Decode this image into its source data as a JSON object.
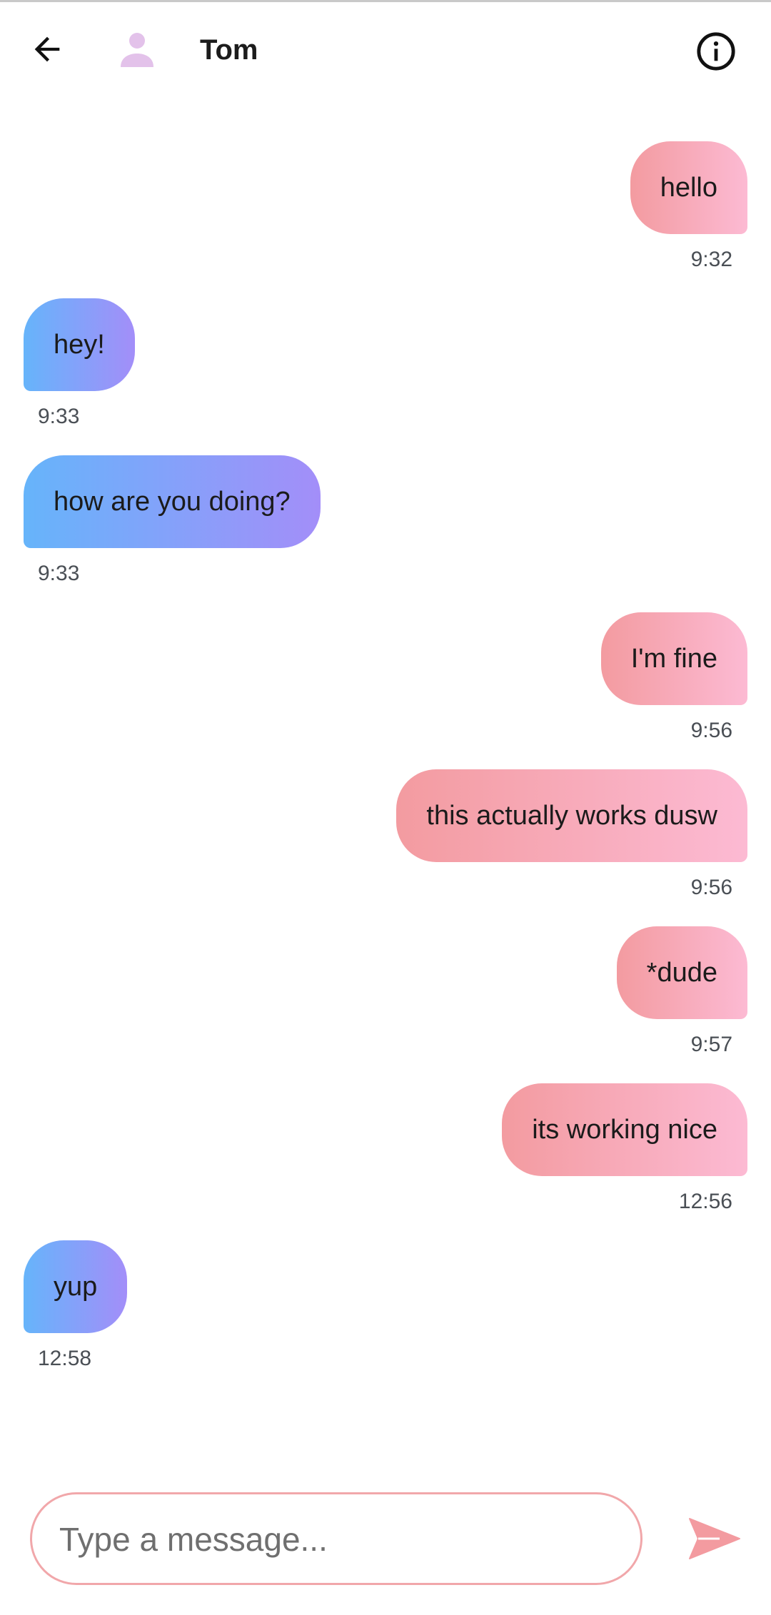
{
  "header": {
    "contact_name": "Tom",
    "back_icon": "arrow-left-icon",
    "avatar_icon": "person-icon",
    "info_icon": "info-circle-icon"
  },
  "messages": [
    {
      "side": "sent",
      "text": "hello",
      "time": "9:32"
    },
    {
      "side": "received",
      "text": "hey!",
      "time": "9:33"
    },
    {
      "side": "received",
      "text": "how are you doing?",
      "time": "9:33"
    },
    {
      "side": "sent",
      "text": "I'm fine",
      "time": "9:56"
    },
    {
      "side": "sent",
      "text": "this actually works dusw",
      "time": "9:56"
    },
    {
      "side": "sent",
      "text": "*dude",
      "time": "9:57"
    },
    {
      "side": "sent",
      "text": "its working nice",
      "time": "12:56"
    },
    {
      "side": "received",
      "text": "yup",
      "time": "12:58"
    }
  ],
  "composer": {
    "value": "",
    "placeholder": "Type a message...",
    "send_icon": "send-icon"
  },
  "colors": {
    "sent_gradient": [
      "#f39ba0",
      "#fcbad3"
    ],
    "received_gradient": [
      "#66b4fa",
      "#a38ef9"
    ],
    "input_border": "#f1a7aa",
    "send_icon": "#f39ba0",
    "avatar": "#e3c2ea"
  }
}
